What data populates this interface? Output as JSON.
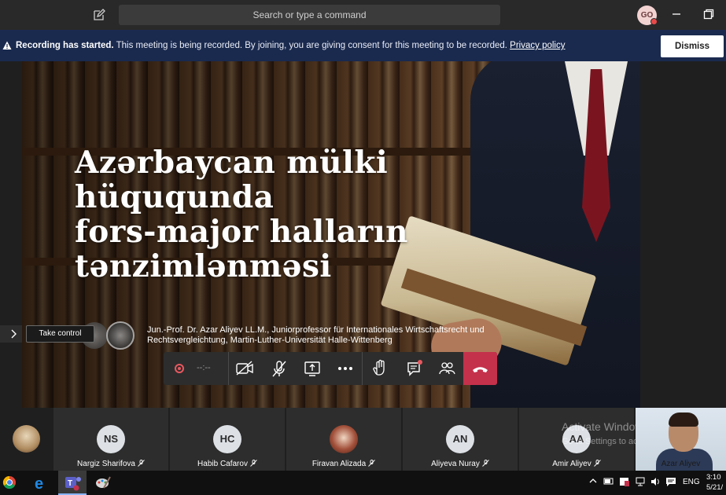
{
  "titlebar": {
    "search_placeholder": "Search or type a command",
    "user_initials": "GO"
  },
  "banner": {
    "title": "Recording has started.",
    "message": "This meeting is being recorded. By joining, you are giving consent for this meeting to be recorded.",
    "link": "Privacy policy",
    "dismiss": "Dismiss"
  },
  "slide": {
    "title_line1": "Azərbaycan mülki hüququnda",
    "title_line2": "fors-major halların",
    "title_line3": "tənzimlənməsi",
    "author_line1": "Jun.-Prof. Dr. Azar Aliyev LL.M., Juniorprofessor für Internationales Wirtschaftsrecht und",
    "author_line2": "Rechtsvergleichtung, Martin-Luther-Universität Halle-Wittenberg"
  },
  "controls": {
    "take_control": "Take control",
    "timer": "--:--"
  },
  "participants": [
    {
      "initials": "NS",
      "name": "Nargiz Sharifova"
    },
    {
      "initials": "HC",
      "name": "Habib Cafarov"
    },
    {
      "initials": "",
      "name": "Firavan Alizada"
    },
    {
      "initials": "AN",
      "name": "Aliyeva Nuray"
    },
    {
      "initials": "AA",
      "name": "Amir Aliyev"
    }
  ],
  "self_video": {
    "name": "Azar Aliyev"
  },
  "watermark": {
    "line1": "Activate Windows",
    "line2": "Go to Settings to activate Windows."
  },
  "taskbar": {
    "language": "ENG",
    "time": "3:10",
    "date": "5/21/"
  },
  "colors": {
    "banner_bg": "#1a2a4f",
    "hangup": "#c4314b",
    "record": "#e8585f"
  }
}
